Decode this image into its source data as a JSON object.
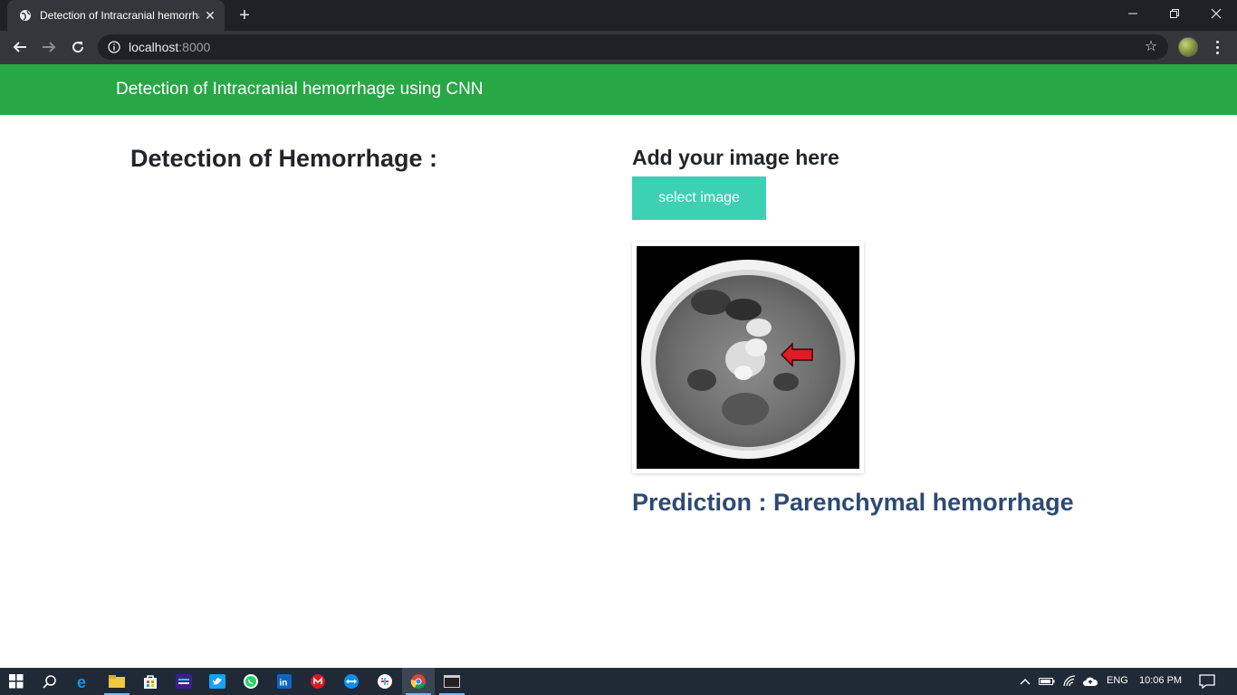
{
  "browser": {
    "tab_title": "Detection of Intracranial hemorrhage using CNN",
    "tab_favicon": "globe-icon",
    "url_host": "localhost",
    "url_port": ":8000"
  },
  "navbar": {
    "brand": "Detection of Intracranial hemorrhage using CNN",
    "color": "#28a745"
  },
  "main": {
    "left_heading": "Detection of Hemorrhage :",
    "upload_heading": "Add your image here",
    "select_button_label": "select image",
    "select_button_color": "#3dd1b3",
    "prediction_text": "Prediction : Parenchymal hemorrhage",
    "prediction_color": "#2d4a73"
  },
  "taskbar": {
    "apps": [
      "windows-start-icon",
      "search-icon",
      "edge-icon",
      "file-explorer-icon",
      "store-icon",
      "amazon-music-icon",
      "twitter-icon",
      "whatsapp-icon",
      "linkedin-icon",
      "gmail-icon",
      "teamviewer-icon",
      "slack-icon",
      "chrome-icon",
      "terminal-icon"
    ],
    "language": "ENG",
    "time": "10:06 PM"
  }
}
